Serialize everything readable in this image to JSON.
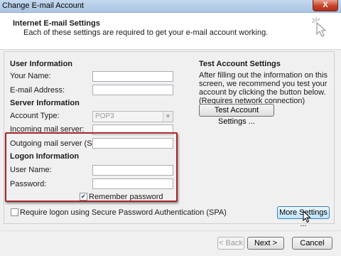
{
  "window": {
    "title": "Change E-mail Account",
    "close_label": "X"
  },
  "header": {
    "title": "Internet E-mail Settings",
    "subtitle": "Each of these settings are required to get your e-mail account working."
  },
  "user_info": {
    "section_title": "User Information",
    "your_name_label": "Your Name:",
    "your_name_value": "",
    "email_label": "E-mail Address:",
    "email_value": ""
  },
  "server_info": {
    "section_title": "Server Information",
    "account_type_label": "Account Type:",
    "account_type_value": "POP3",
    "incoming_label": "Incoming mail server:",
    "incoming_value": "",
    "outgoing_label": "Outgoing mail server (SMTP):",
    "outgoing_value": ""
  },
  "logon_info": {
    "section_title": "Logon Information",
    "username_label": "User Name:",
    "username_value": "",
    "password_label": "Password:",
    "password_value": "",
    "remember_label": "Remember password",
    "remember_checked": true,
    "spa_label": "Require logon using Secure Password Authentication (SPA)",
    "spa_checked": false
  },
  "test_settings": {
    "section_title": "Test Account Settings",
    "description": "After filling out the information on this screen, we recommend you test your account by clicking the button below. (Requires network connection)",
    "button_label": "Test Account Settings ..."
  },
  "more_settings_label": "More Settings ...",
  "footer": {
    "back_label": "< Back",
    "next_label": "Next >",
    "cancel_label": "Cancel"
  },
  "colors": {
    "highlight": "#a5262b",
    "title_bar": "#c5d9ee",
    "close_button": "#c7432a"
  },
  "icons": {
    "header_icon": "cursor-click-icon",
    "mouse_pointer": "mouse-pointer-icon"
  }
}
